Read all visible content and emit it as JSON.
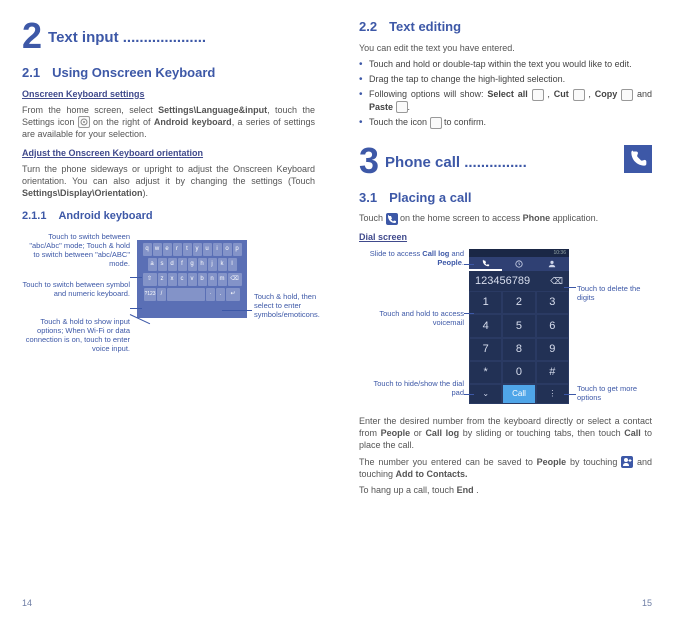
{
  "left": {
    "chapter_num": "2",
    "chapter_title": "Text input ....................",
    "sec21_num": "2.1",
    "sec21_title": "Using Onscreen Keyboard",
    "h_okb": "Onscreen Keyboard settings",
    "p_okb": "From the home screen, select Settings\\Language&input, touch the Settings icon  on the right of Android keyboard, a series of settings are available for your selection.",
    "p_okb_a": "From the home screen, select ",
    "p_okb_b": "Settings\\Language&input",
    "p_okb_c": ", touch the Settings icon ",
    "p_okb_d": " on the right of ",
    "p_okb_e": "Android keyboard",
    "p_okb_f": ", a series of settings are available for your selection.",
    "h_orient": "Adjust the Onscreen Keyboard orientation",
    "p_orient_a": "Turn the phone sideways or upright to adjust the Onscreen Keyboard orientation. You can also adjust it by changing the settings (Touch ",
    "p_orient_b": "Settings\\Display\\Orientation",
    "p_orient_c": ").",
    "sec211_num": "2.1.1",
    "sec211_title": "Android keyboard",
    "kb_labels": {
      "l1": "Touch to switch between \"abc/Abc\" mode; Touch & hold to switch between \"abc/ABC\" mode.",
      "l2": "Touch to switch between symbol and numeric keyboard.",
      "l3": "Touch & hold to show input options; When Wi-Fi or data connection is on, touch to enter voice input.",
      "r1": "Touch & hold, then select to enter symbols/emoticons."
    },
    "kb_keys": {
      "r1": [
        "q",
        "w",
        "e",
        "r",
        "t",
        "y",
        "u",
        "i",
        "o",
        "p"
      ],
      "r2": [
        "a",
        "s",
        "d",
        "f",
        "g",
        "h",
        "j",
        "k",
        "l"
      ],
      "r3": [
        "⇧",
        "z",
        "x",
        "c",
        "v",
        "b",
        "n",
        "m",
        "⌫"
      ],
      "r4": [
        "?123",
        "/",
        "",
        "·",
        ".",
        "↵"
      ]
    },
    "page_num": "14"
  },
  "right": {
    "sec22_num": "2.2",
    "sec22_title": "Text editing",
    "p_intro": "You can edit the text you have entered.",
    "b1": "Touch and hold or double-tap within the text you would like to edit.",
    "b2": "Drag the tap to change the high-lighted selection.",
    "b3_a": "Following options will show: ",
    "b3_sel": "Select all",
    "b3_cut": "Cut",
    "b3_copy": "Copy",
    "b3_and": " and ",
    "b3_paste": "Paste",
    "b4_a": "Touch the icon ",
    "b4_b": " to confirm.",
    "chapter_num": "3",
    "chapter_title": "Phone call ...............",
    "sec31_num": "3.1",
    "sec31_title": "Placing a call",
    "p_phone_a": "Touch ",
    "p_phone_b": " on the home screen to access ",
    "p_phone_c": "Phone",
    "p_phone_d": " application.",
    "h_dial": "Dial screen",
    "dial_status_time": "10:36",
    "dial_number": "123456789",
    "dial_keys": [
      "1",
      "2",
      "3",
      "4",
      "5",
      "6",
      "7",
      "8",
      "9",
      "*",
      "0",
      "#"
    ],
    "dial_call": "Call",
    "dial_labels": {
      "l1": "Slide to access Call log and People.",
      "l2": "Touch and hold to access voicemail",
      "l3": "Touch to hide/show the dial pad",
      "r1": "Touch to delete the digits",
      "r2": "Touch to get more options"
    },
    "p_enter_a": "Enter the desired number from the keyboard directly or select a contact from ",
    "p_enter_people": "People",
    "p_enter_or": " or ",
    "p_enter_calllog": "Call log",
    "p_enter_b": " by sliding or touching tabs, then touch ",
    "p_enter_call": "Call",
    "p_enter_c": " to place the call.",
    "p_save_a": "The number you entered can be saved to ",
    "p_save_people": "People",
    "p_save_b": " by touching ",
    "p_save_c": " and touching ",
    "p_save_add": "Add to Contacts.",
    "p_hang_a": "To hang up a call, touch ",
    "p_hang_end": "End",
    "p_hang_b": " .",
    "page_num": "15"
  }
}
